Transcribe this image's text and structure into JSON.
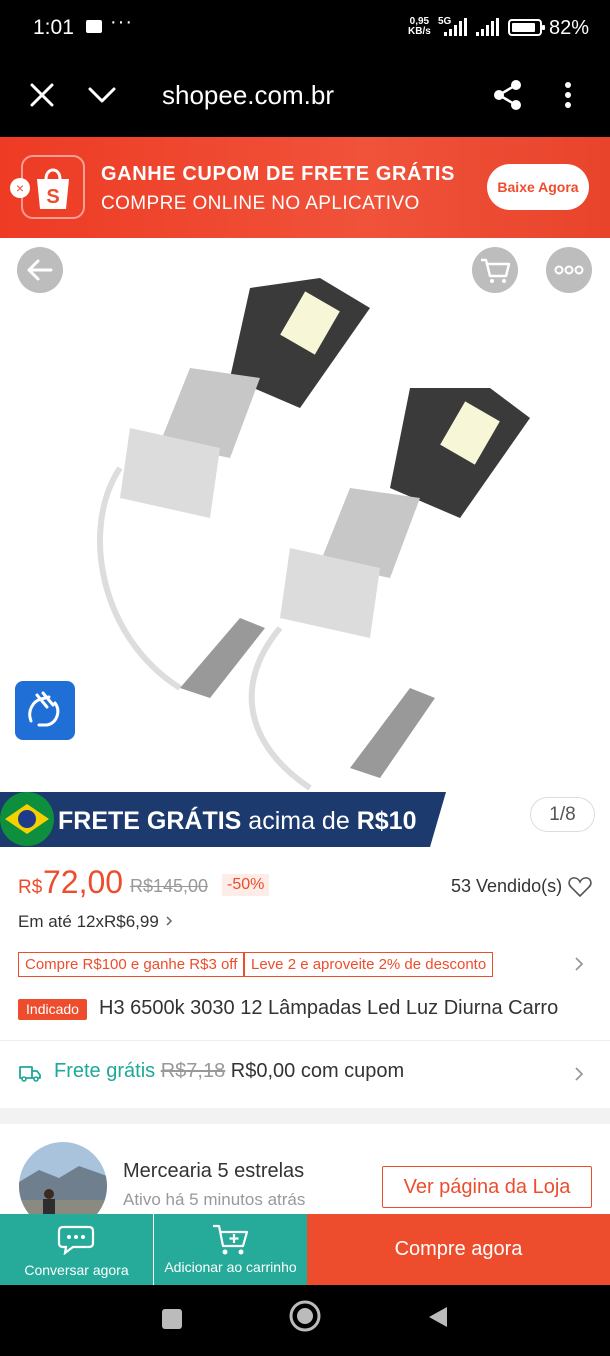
{
  "status": {
    "time": "1:01",
    "dots": "···",
    "speed_top": "0,95",
    "speed_bottom": "KB/s",
    "network": "5G",
    "battery": "82%"
  },
  "browser": {
    "url": "shopee.com.br"
  },
  "banner": {
    "line1": "GANHE CUPOM DE FRETE GRÁTIS",
    "line2": "COMPRE ONLINE NO APLICATIVO",
    "button": "Baixe Agora",
    "logo_letter": "S",
    "close": "×"
  },
  "gallery": {
    "pager": "1/8"
  },
  "frete_banner": {
    "bold": "FRETE GRÁTIS",
    "text": "acima de",
    "amount": "R$10"
  },
  "price": {
    "currency": "R$",
    "value": "72,00",
    "original": "R$145,00",
    "discount": "-50%",
    "sold": "53 Vendido(s)",
    "installments": "Em até 12xR$6,99"
  },
  "vouchers": [
    "Compre R$100 e ganhe R$3 off",
    "Leve 2 e aproveite 2% de desconto"
  ],
  "product": {
    "tag": "Indicado",
    "title": "H3 6500k 3030 12 Lâmpadas Led Luz Diurna Carro"
  },
  "shipping": {
    "label": "Frete grátis",
    "old_price": "R$7,18",
    "new_text": "R$0,00 com cupom"
  },
  "shop": {
    "name": "Mercearia 5 estrelas",
    "active": "Ativo há 5 minutos atrás",
    "button": "Ver página da Loja"
  },
  "actions": {
    "chat": "Conversar agora",
    "cart": "Adicionar ao carrinho",
    "buy": "Compre agora"
  },
  "colors": {
    "brand": "#ee4d2d",
    "teal": "#26aa99"
  }
}
